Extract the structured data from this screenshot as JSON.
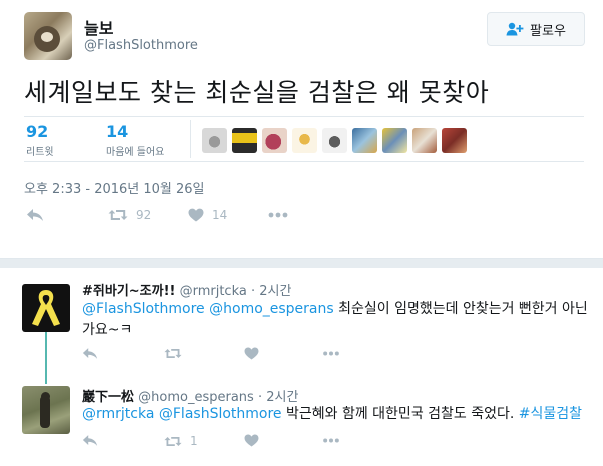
{
  "tweet": {
    "author_name": "늘보",
    "author_handle": "@FlashSlothmore",
    "follow_label": "팔로우",
    "text": "세계일보도 찾는 최순실을 검찰은 왜 못찾아",
    "retweets_count": "92",
    "retweets_label": "리트윗",
    "likes_count": "14",
    "likes_label": "마음에 들어요",
    "timestamp": "오후 2:33 - 2016년 10월 26일",
    "action_retweet_count": "92",
    "action_like_count": "14"
  },
  "replies": [
    {
      "name": "#쥐바기~조까!!",
      "handle": "@rmrjtcka",
      "time": "· 2시간",
      "mention1": "@FlashSlothmore",
      "mention2": "@homo_esperans",
      "text": " 최순실이 임명했는데 안찾는거 뻔한거 아닌가요~ㅋ"
    },
    {
      "name": "巖下一松",
      "handle": "@homo_esperans",
      "time": "· 2시간",
      "mention1": "@rmrjtcka",
      "mention2": "@FlashSlothmore",
      "text": " 박근혜와 함께 대한민국 검찰도 죽었다. ",
      "hashtag": "#식물검찰",
      "retweet_count": "1"
    }
  ],
  "icons": {
    "reply": "reply-icon",
    "retweet": "retweet-icon",
    "like": "heart-icon",
    "more": "more-icon",
    "follow": "follow-person-icon"
  },
  "colors": {
    "link": "#1b95e0",
    "muted": "#657786",
    "icon": "#aab8c2",
    "thread_line": "#56b8b0"
  }
}
